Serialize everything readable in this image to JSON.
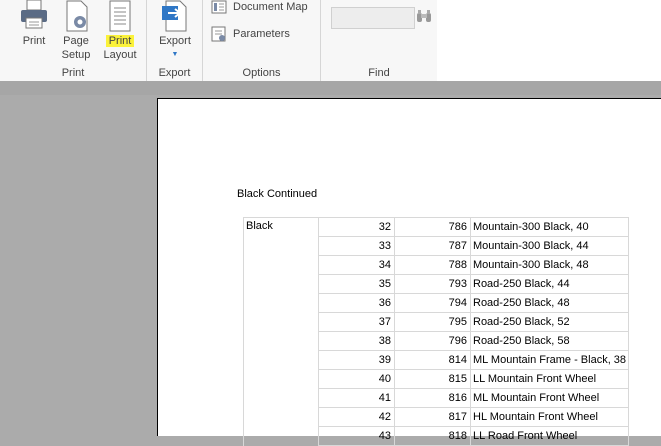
{
  "ribbon": {
    "print_group": {
      "label": "Print",
      "buttons": [
        {
          "label": "Print",
          "icon": "printer-icon"
        },
        {
          "label": "Page Setup",
          "line1": "Page",
          "line2": "Setup",
          "icon": "page-setup-icon"
        },
        {
          "label": "Print Layout",
          "line1": "Print",
          "line2": "Layout",
          "icon": "print-layout-icon",
          "highlighted": true
        }
      ]
    },
    "export_group": {
      "label": "Export",
      "button": {
        "label": "Export",
        "icon": "export-icon"
      }
    },
    "options_group": {
      "label": "Options",
      "items": [
        {
          "label": "Document Map",
          "icon": "document-map-icon"
        },
        {
          "label": "Parameters",
          "icon": "parameters-icon"
        }
      ]
    },
    "find_group": {
      "label": "Find",
      "search_value": "",
      "button_icon": "binoculars-icon"
    },
    "highlight_color": "#fbf23a"
  },
  "report": {
    "subtitle": "Black Continued",
    "group_label": "Black",
    "rows": [
      {
        "n": "32",
        "id": "786",
        "name": "Mountain-300 Black, 40"
      },
      {
        "n": "33",
        "id": "787",
        "name": "Mountain-300 Black, 44"
      },
      {
        "n": "34",
        "id": "788",
        "name": "Mountain-300 Black, 48"
      },
      {
        "n": "35",
        "id": "793",
        "name": "Road-250 Black, 44"
      },
      {
        "n": "36",
        "id": "794",
        "name": "Road-250 Black, 48"
      },
      {
        "n": "37",
        "id": "795",
        "name": "Road-250 Black, 52"
      },
      {
        "n": "38",
        "id": "796",
        "name": "Road-250 Black, 58"
      },
      {
        "n": "39",
        "id": "814",
        "name": "ML Mountain Frame - Black, 38"
      },
      {
        "n": "40",
        "id": "815",
        "name": "LL Mountain Front Wheel"
      },
      {
        "n": "41",
        "id": "816",
        "name": "ML Mountain Front Wheel"
      },
      {
        "n": "42",
        "id": "817",
        "name": "HL Mountain Front Wheel"
      },
      {
        "n": "43",
        "id": "818",
        "name": "LL Road Front Wheel"
      }
    ]
  }
}
